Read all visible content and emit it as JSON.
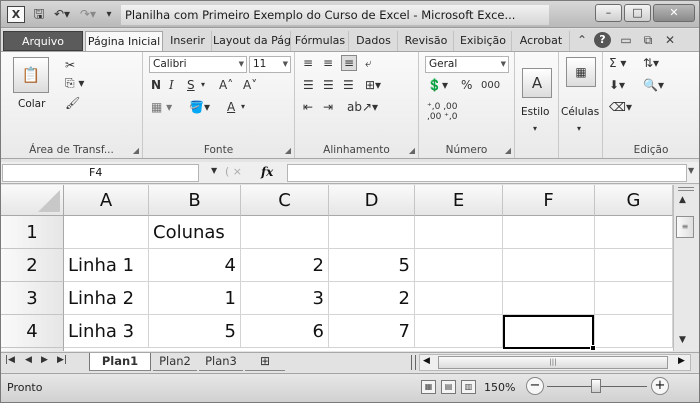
{
  "titlebar": {
    "title": "Planilha com Primeiro Exemplo do Curso de Excel  -  Microsoft Exce...",
    "app_icon": "excel-icon",
    "minimize": "–",
    "maximize": "□",
    "close": "✕"
  },
  "tabs": {
    "file": "Arquivo",
    "page": "Página Inicial",
    "insert": "Inserir",
    "layout": "Layout da Página",
    "formulas": "Fórmulas",
    "data": "Dados",
    "review": "Revisão",
    "view": "Exibição",
    "acrobat": "Acrobat"
  },
  "ribbon": {
    "clipboard": {
      "paste_label": "Colar",
      "group_label": "Área de Transf..."
    },
    "font": {
      "font_name": "Calibri",
      "font_size": "11",
      "bold": "N",
      "italic": "I",
      "underline": "S",
      "grow": "A˄",
      "shrink": "A˅",
      "color": "A",
      "group_label": "Fonte"
    },
    "alignment": {
      "group_label": "Alinhamento"
    },
    "number": {
      "format": "Geral",
      "percent": "%",
      "thousands": "000",
      "inc_decimal": "⁺,0 ,00",
      "dec_decimal": ",00 ⁺,0",
      "group_label": "Número"
    },
    "styles": {
      "label": "Estilo"
    },
    "cells": {
      "label": "Células"
    },
    "editing": {
      "sigma": "Σ",
      "group_label": "Edição"
    }
  },
  "formula_bar": {
    "name_box": "F4",
    "fx": "fx",
    "formula": ""
  },
  "sheet": {
    "columns": [
      "A",
      "B",
      "C",
      "D",
      "E",
      "F",
      "G"
    ],
    "rows": [
      {
        "num": "1",
        "cells": [
          "",
          "Colunas",
          "",
          "",
          "",
          "",
          ""
        ]
      },
      {
        "num": "2",
        "cells": [
          "Linha 1",
          "4",
          "2",
          "5",
          "",
          "",
          ""
        ]
      },
      {
        "num": "3",
        "cells": [
          "Linha 2",
          "1",
          "3",
          "2",
          "",
          "",
          ""
        ]
      },
      {
        "num": "4",
        "cells": [
          "Linha 3",
          "5",
          "6",
          "7",
          "",
          "",
          ""
        ]
      }
    ],
    "selected_cell": "F4"
  },
  "sheet_tabs": [
    "Plan1",
    "Plan2",
    "Plan3"
  ],
  "status": {
    "text": "Pronto",
    "zoom": "150%"
  }
}
